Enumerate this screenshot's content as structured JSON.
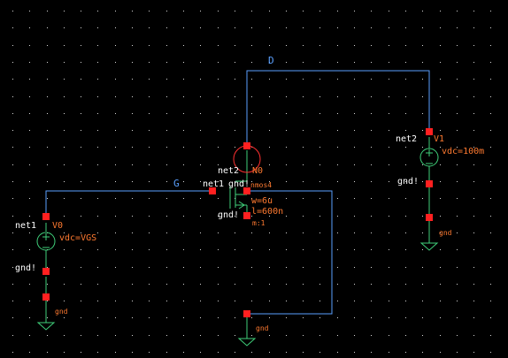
{
  "colors": {
    "background": "#000000",
    "grid_dot": "#d8d8d8",
    "wire": "#5aa0ff",
    "pin": "#ff2020",
    "label_white": "#ffffff",
    "label_orange": "#ff7a30",
    "label_blue": "#5aa0ff",
    "source_green": "#3fcf7a",
    "transistor_green": "#3fcf7a",
    "ground_green": "#3fcf7a"
  },
  "wires": {
    "drain": "D",
    "gate": "G"
  },
  "transistor": {
    "net_drain": "net2",
    "net_gate": "net1",
    "net_bulk": "gnd!",
    "net_source": "gnd!",
    "name": "N0",
    "model": "nmos4",
    "width": "w=6u",
    "length": "l=600n",
    "multiplier": "m:1"
  },
  "source_v0": {
    "net_plus": "net1",
    "name": "V0",
    "value": "vdc=VGS",
    "net_minus": "gnd!",
    "ground_label": "gnd"
  },
  "source_v1": {
    "net_plus": "net2",
    "name": "V1",
    "value": "vdc=100m",
    "net_minus": "gnd!",
    "ground_label": "gnd"
  },
  "ground_center": {
    "label": "gnd"
  }
}
